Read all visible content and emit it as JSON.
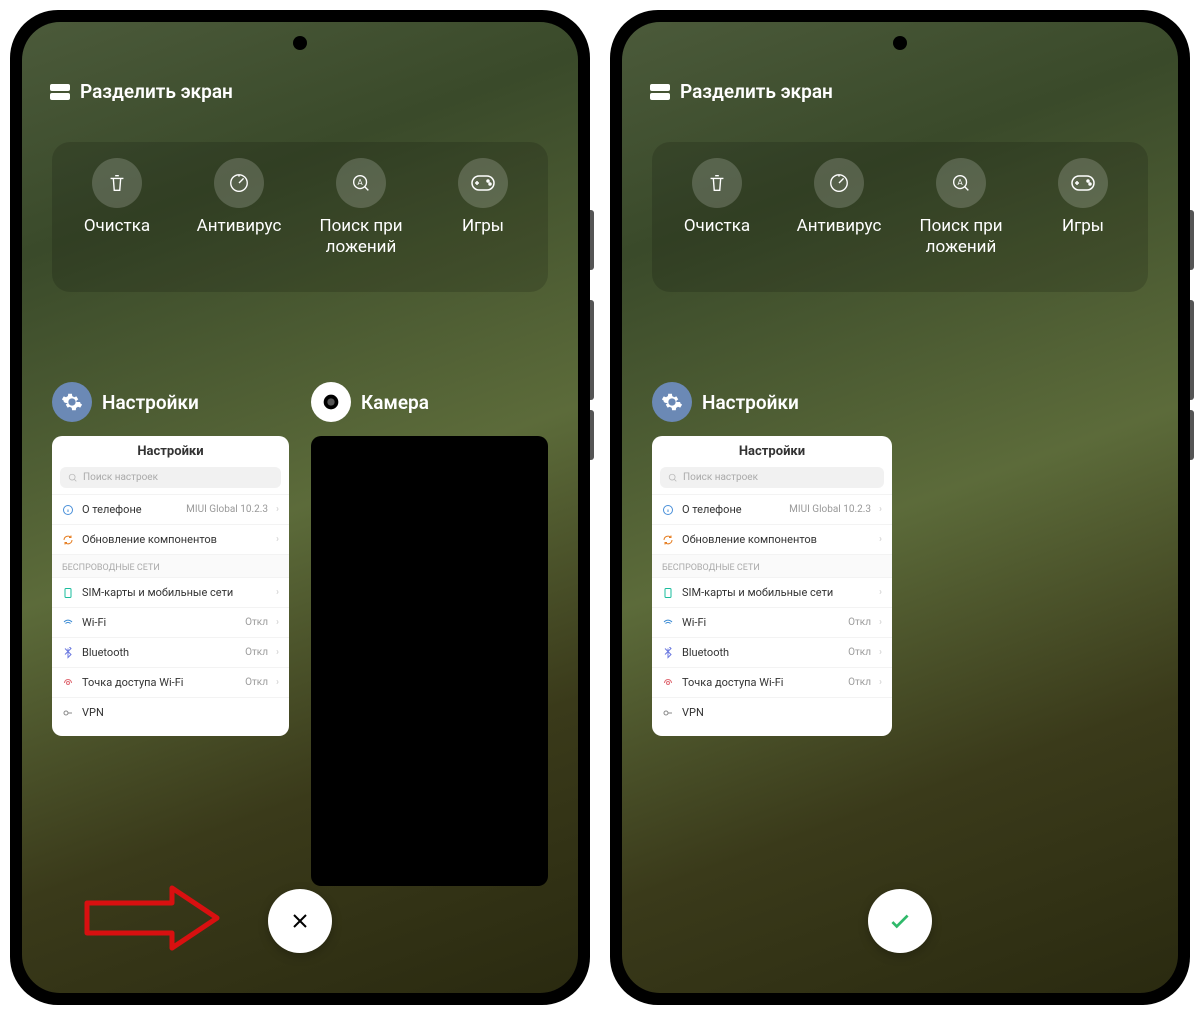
{
  "header": {
    "split_label": "Разделить экран"
  },
  "tools": {
    "clean": "Очистка",
    "antivirus": "Антивирус",
    "appsearch": "Поиск при\nложений",
    "games": "Игры"
  },
  "recents": {
    "settings_label": "Настройки",
    "camera_label": "Камера"
  },
  "settings_preview": {
    "title": "Настройки",
    "search_placeholder": "Поиск настроек",
    "about_label": "О телефоне",
    "about_value": "MIUI Global 10.2.3",
    "update_label": "Обновление компонентов",
    "section_wireless": "БЕСПРОВОДНЫЕ СЕТИ",
    "sim_label": "SIM-карты и мобильные сети",
    "wifi_label": "Wi-Fi",
    "wifi_value": "Откл",
    "bt_label": "Bluetooth",
    "bt_value": "Откл",
    "hotspot_label": "Точка доступа Wi-Fi",
    "hotspot_value": "Откл",
    "vpn_label": "VPN"
  },
  "colors": {
    "settings_icon_bg": "#6b89b5",
    "check_green": "#2fb96a",
    "arrow_red": "#d81010"
  }
}
